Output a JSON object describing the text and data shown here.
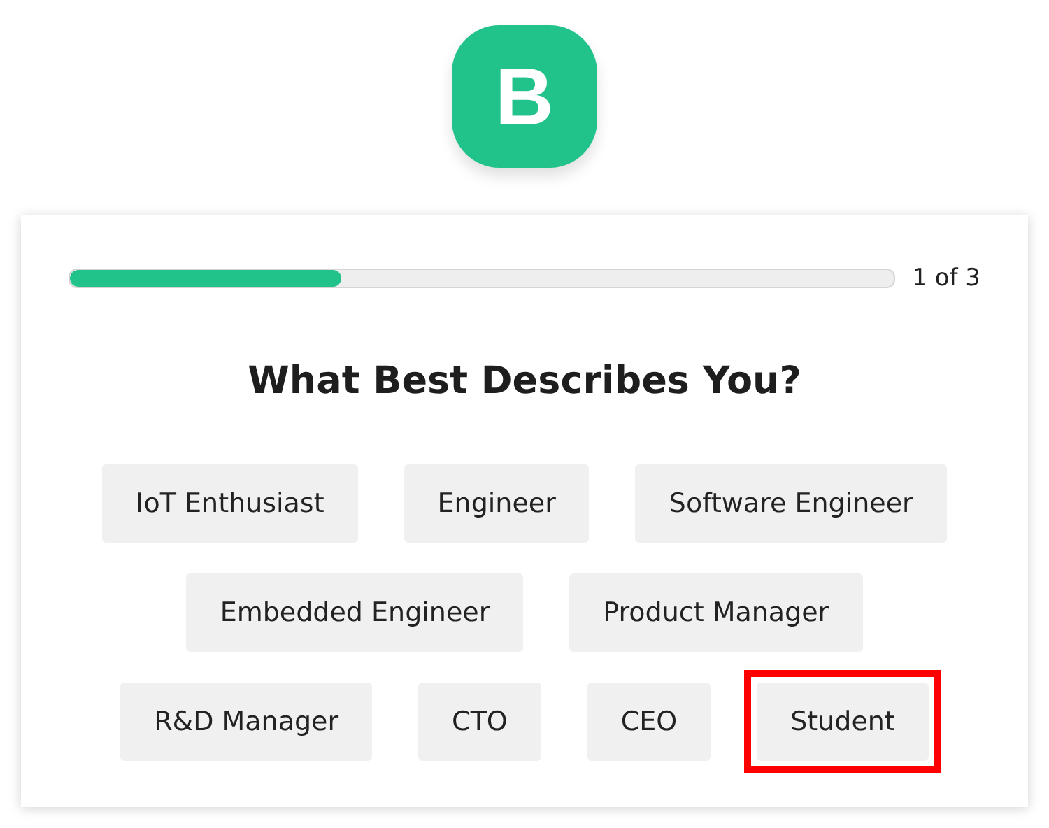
{
  "logo": {
    "letter": "B"
  },
  "progress": {
    "level": 0.33,
    "reading": "1 of 3"
  },
  "title": "What Best Describes You?",
  "option_rows": [
    [
      {
        "label": "IoT Enthusiast",
        "highlighted": false
      },
      {
        "label": "Engineer",
        "highlighted": false
      },
      {
        "label": "Software Engineer",
        "highlighted": false
      }
    ],
    [
      {
        "label": "Embedded Engineer",
        "highlighted": false
      },
      {
        "label": "Product Manager",
        "highlighted": false
      }
    ],
    [
      {
        "label": "R&D Manager",
        "highlighted": false
      },
      {
        "label": "CTO",
        "highlighted": false
      },
      {
        "label": "CEO",
        "highlighted": false
      },
      {
        "label": "Student",
        "highlighted": true
      }
    ]
  ]
}
